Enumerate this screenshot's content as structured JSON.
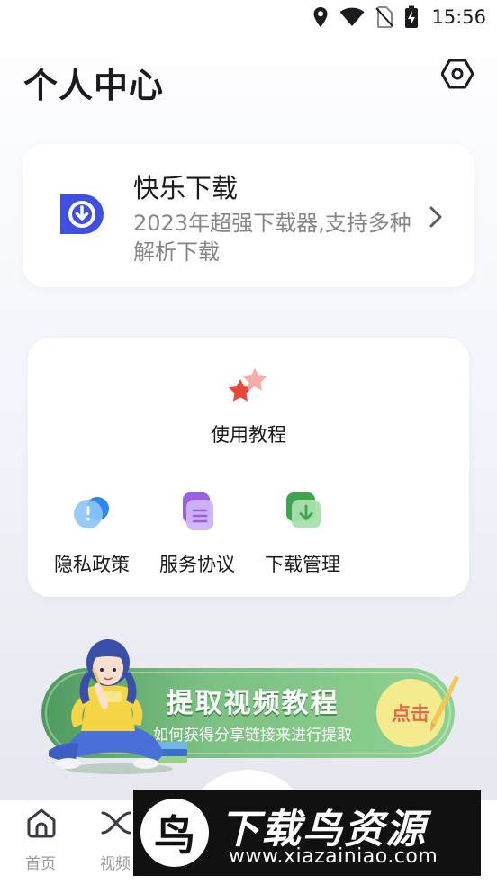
{
  "status_bar": {
    "time": "15:56",
    "icons": [
      "location-icon",
      "wifi-icon",
      "no-sim-icon",
      "battery-charging-icon"
    ]
  },
  "header": {
    "title": "个人中心",
    "settings_icon": "settings-hex-icon"
  },
  "app_card": {
    "name": "快乐下载",
    "description": "2023年超强下载器,支持多种解析下载",
    "logo_color": "#3f4fe0"
  },
  "tools": {
    "tutorial_label": "使用教程",
    "items": [
      {
        "label": "隐私政策",
        "icon": "privacy-icon",
        "color": "#3d9af0"
      },
      {
        "label": "服务协议",
        "icon": "agreement-icon",
        "color": "#a86ce8"
      },
      {
        "label": "下载管理",
        "icon": "download-manage-icon",
        "color": "#4ab35a"
      }
    ]
  },
  "banner": {
    "title": "提取视频教程",
    "subtitle": "如何获得分享链接来进行提取",
    "cta": "点击"
  },
  "bottom_nav": {
    "items": [
      {
        "label": "首页",
        "icon": "home-icon"
      },
      {
        "label": "视频",
        "icon": "video-icon"
      }
    ]
  },
  "watermark": {
    "logo_text": "鸟",
    "title": "下载鸟资源",
    "url": "www.xiazainiao.com"
  }
}
